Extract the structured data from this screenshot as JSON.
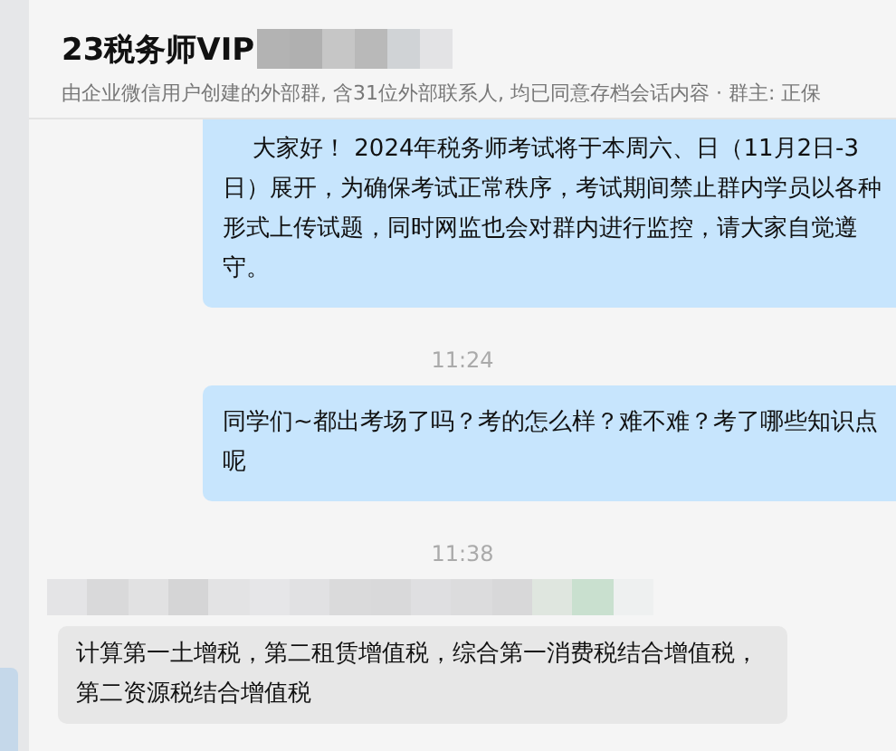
{
  "header": {
    "title": "23税务师VIP",
    "subtitle": "由企业微信用户创建的外部群, 含31位外部联系人, 均已同意存档会话内容  · 群主: 正保"
  },
  "messages": [
    {
      "kind": "outgoing",
      "text": "    大家好！ 2024年税务师考试将于本周六、日（11月2日-3日）展开，为确保考试正常秩序，考试期间禁止群内学员以各种形式上传试题，同时网监也会对群内进行监控，请大家自觉遵守。"
    },
    {
      "kind": "time",
      "text": "11:24"
    },
    {
      "kind": "outgoing",
      "text": "同学们~都出考场了吗？考的怎么样？难不难？考了哪些知识点呢"
    },
    {
      "kind": "time",
      "text": "11:38"
    },
    {
      "kind": "incoming",
      "text": "计算第一土增税，第二租赁增值税，综合第一消费税结合增值税，第二资源税结合增值税"
    }
  ]
}
